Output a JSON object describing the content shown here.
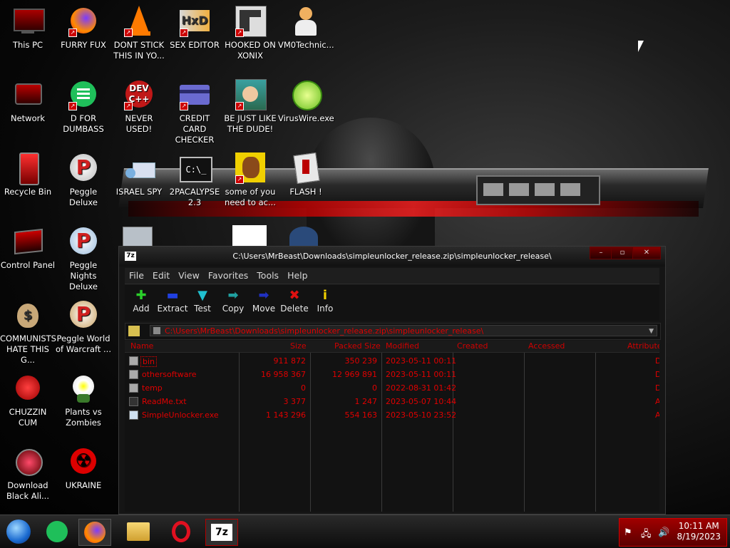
{
  "desktop": {
    "icons": [
      {
        "label": "This PC"
      },
      {
        "label": "FURRY FUX"
      },
      {
        "label": "DONT STICK THIS IN YO..."
      },
      {
        "label": "SEX EDITOR"
      },
      {
        "label": "HOOKED ON XONIX"
      },
      {
        "label": "VM0Technic..."
      },
      {
        "label": "Network"
      },
      {
        "label": "D FOR DUMBASS"
      },
      {
        "label": "NEVER USED!"
      },
      {
        "label": "CREDIT CARD CHECKER"
      },
      {
        "label": "BE JUST LIKE THE DUDE!"
      },
      {
        "label": "VirusWire.exe"
      },
      {
        "label": "Recycle Bin"
      },
      {
        "label": "Peggle Deluxe"
      },
      {
        "label": "ISRAEL SPY"
      },
      {
        "label": "2PACALYPSE 2.3"
      },
      {
        "label": "some of you need to ac..."
      },
      {
        "label": "FLASH !"
      },
      {
        "label": "Control Panel"
      },
      {
        "label": "Peggle Nights Deluxe"
      },
      {
        "label": "COMMUNISTS HATE THIS G..."
      },
      {
        "label": "Peggle World of Warcraft ..."
      },
      {
        "label": "CHUZZIN CUM"
      },
      {
        "label": "Plants vs Zombies"
      },
      {
        "label": "Download Black Ali..."
      },
      {
        "label": "UKRAINE"
      }
    ]
  },
  "window": {
    "title": "C:\\Users\\MrBeast\\Downloads\\simpleunlocker_release.zip\\simpleunlocker_release\\",
    "app_icon": "7z",
    "menu": [
      "File",
      "Edit",
      "View",
      "Favorites",
      "Tools",
      "Help"
    ],
    "toolbar": [
      "Add",
      "Extract",
      "Test",
      "Copy",
      "Move",
      "Delete",
      "Info"
    ],
    "address": "C:\\Users\\MrBeast\\Downloads\\simpleunlocker_release.zip\\simpleunlocker_release\\",
    "columns": [
      "Name",
      "Size",
      "Packed Size",
      "Modified",
      "Created",
      "Accessed",
      "Attribute"
    ],
    "files": [
      {
        "name": "bin",
        "size": "911 872",
        "packed": "350 239",
        "modified": "2023-05-11 00:11",
        "attr": "D"
      },
      {
        "name": "othersoftware",
        "size": "16 958 367",
        "packed": "12 969 891",
        "modified": "2023-05-11 00:11",
        "attr": "D"
      },
      {
        "name": "temp",
        "size": "0",
        "packed": "0",
        "modified": "2022-08-31 01:42",
        "attr": "D"
      },
      {
        "name": "ReadMe.txt",
        "size": "3 377",
        "packed": "1 247",
        "modified": "2023-05-07 10:44",
        "attr": "A"
      },
      {
        "name": "SimpleUnlocker.exe",
        "size": "1 143 296",
        "packed": "554 163",
        "modified": "2023-05-10 23:52",
        "attr": "A"
      }
    ]
  },
  "taskbar": {
    "app_label_7z": "7z",
    "time": "10:11 AM",
    "date": "8/19/2023"
  },
  "colors": {
    "accent": "#cc0000",
    "tray": "#a00000"
  }
}
